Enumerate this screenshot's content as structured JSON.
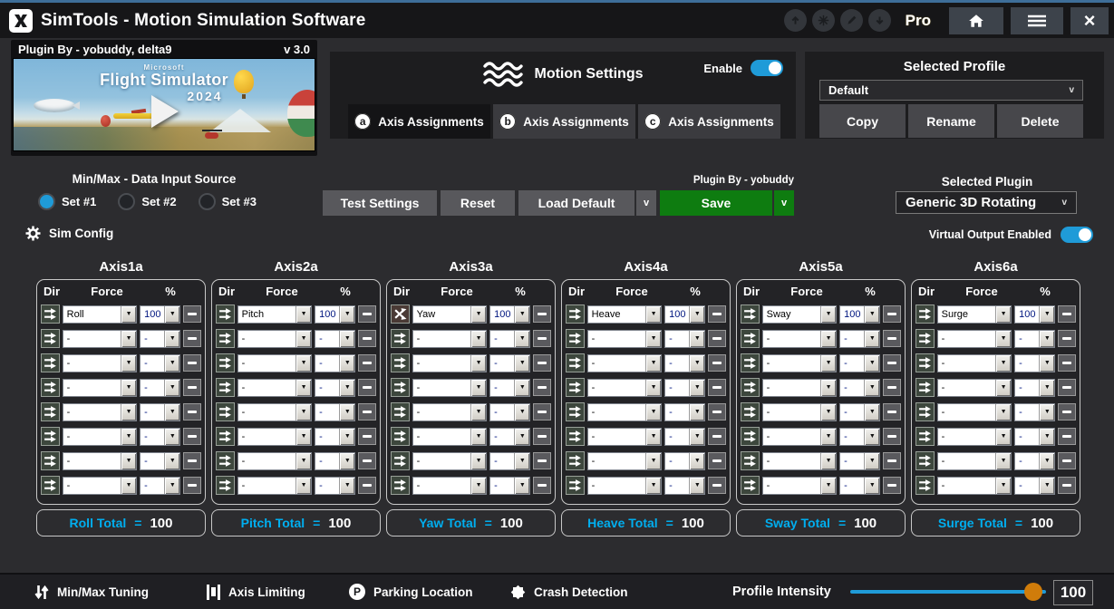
{
  "titlebar": {
    "title": "SimTools - Motion Simulation Software",
    "pro_label": "Pro"
  },
  "plugin_header": {
    "plugin_by": "Plugin By - yobuddy, delta9",
    "version": "v 3.0"
  },
  "banner": {
    "brand": "Microsoft",
    "title": "Flight Simulator",
    "year": "2024"
  },
  "motion_settings": {
    "title": "Motion Settings",
    "enable_label": "Enable",
    "enable_on": true,
    "tabs": [
      {
        "letter": "a",
        "label": "Axis Assignments",
        "active": true
      },
      {
        "letter": "b",
        "label": "Axis Assignments",
        "active": false
      },
      {
        "letter": "c",
        "label": "Axis Assignments",
        "active": false
      }
    ]
  },
  "profile": {
    "title": "Selected Profile",
    "selected": "Default",
    "caret": "v",
    "copy": "Copy",
    "rename": "Rename",
    "delete": "Delete"
  },
  "data_input": {
    "title": "Min/Max - Data Input Source",
    "options": [
      {
        "label": "Set #1",
        "selected": true
      },
      {
        "label": "Set #2",
        "selected": false
      },
      {
        "label": "Set #3",
        "selected": false
      }
    ]
  },
  "actions": {
    "plugin_by": "Plugin By - yobuddy",
    "test": "Test Settings",
    "reset": "Reset",
    "load_default": "Load Default",
    "save": "Save",
    "caret": "v"
  },
  "plugin_select": {
    "title": "Selected Plugin",
    "selected": "Generic 3D Rotating",
    "caret": "v",
    "virtual_output_label": "Virtual Output Enabled",
    "virtual_output_on": true
  },
  "sim_config_label": "Sim Config",
  "axes": {
    "headers": {
      "dir": "Dir",
      "force": "Force",
      "pct": "%"
    },
    "empty_value": "-",
    "equals": "=",
    "rows_per_column": 8,
    "columns": [
      {
        "title": "Axis1a",
        "total_label": "Roll Total",
        "total": "100",
        "rows": [
          {
            "dir": "straight",
            "force": "Roll",
            "pct": "100"
          }
        ]
      },
      {
        "title": "Axis2a",
        "total_label": "Pitch Total",
        "total": "100",
        "rows": [
          {
            "dir": "straight",
            "force": "Pitch",
            "pct": "100"
          }
        ]
      },
      {
        "title": "Axis3a",
        "total_label": "Yaw Total",
        "total": "100",
        "rows": [
          {
            "dir": "cross",
            "force": "Yaw",
            "pct": "100"
          }
        ]
      },
      {
        "title": "Axis4a",
        "total_label": "Heave Total",
        "total": "100",
        "rows": [
          {
            "dir": "straight",
            "force": "Heave",
            "pct": "100"
          }
        ]
      },
      {
        "title": "Axis5a",
        "total_label": "Sway Total",
        "total": "100",
        "rows": [
          {
            "dir": "straight",
            "force": "Sway",
            "pct": "100"
          }
        ]
      },
      {
        "title": "Axis6a",
        "total_label": "Surge Total",
        "total": "100",
        "rows": [
          {
            "dir": "straight",
            "force": "Surge",
            "pct": "100"
          }
        ]
      }
    ]
  },
  "bottombar": {
    "items": [
      {
        "icon": "minmax-tuning-icon",
        "label": "Min/Max Tuning"
      },
      {
        "icon": "axis-limiting-icon",
        "label": "Axis Limiting"
      },
      {
        "icon": "parking-location-icon",
        "label": "Parking Location"
      },
      {
        "icon": "crash-detection-icon",
        "label": "Crash Detection"
      }
    ],
    "intensity_label": "Profile Intensity",
    "intensity_value": "100"
  },
  "colors": {
    "accent_blue": "#1f9bd8",
    "save_green": "#0e7c10",
    "total_cyan": "#00aeef",
    "slider_thumb_orange": "#d07c0a",
    "titlebar_top_line": "#3e6e99"
  }
}
